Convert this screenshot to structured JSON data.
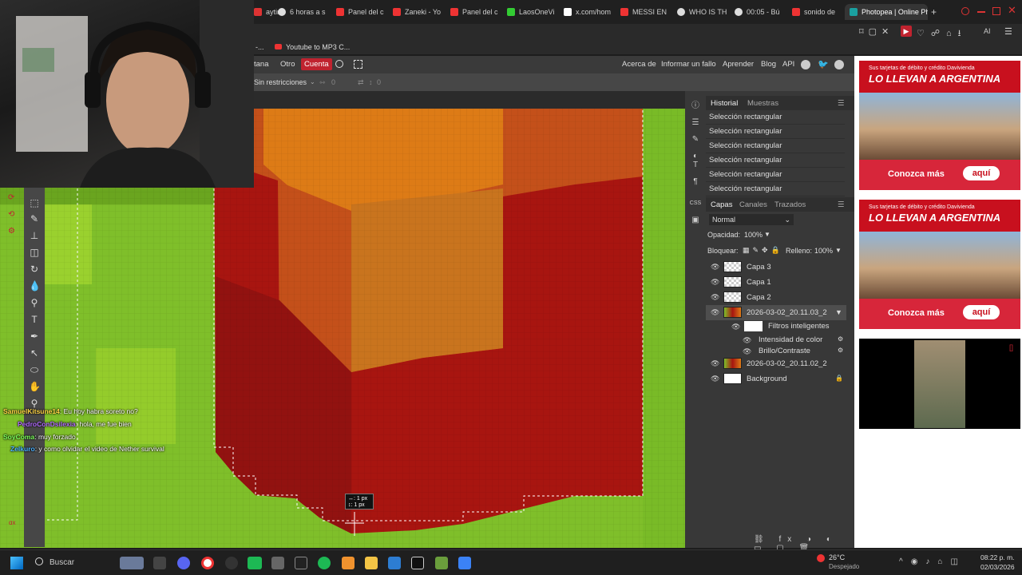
{
  "browser": {
    "tabs": [
      {
        "label": "aytin",
        "color": "#d33"
      },
      {
        "label": "6 horas a s",
        "color": "#ddd"
      },
      {
        "label": "Panel del c",
        "color": "#e33"
      },
      {
        "label": "Zaneki - Yo",
        "color": "#e33"
      },
      {
        "label": "Panel del c",
        "color": "#e33"
      },
      {
        "label": "LaosOneVi",
        "color": "#3c3"
      },
      {
        "label": "x.com/hom",
        "color": "#fff"
      },
      {
        "label": "MESSI EN",
        "color": "#e33"
      },
      {
        "label": "WHO IS TH",
        "color": "#ddd"
      },
      {
        "label": "00:05 - Bú",
        "color": "#ddd"
      },
      {
        "label": "sonido de",
        "color": "#e33"
      },
      {
        "label": "Photopea | Online Ph",
        "color": "#1aa0a0"
      }
    ],
    "new_tab": "+",
    "bookmark": "Youtube to MP3 C...",
    "bookmark_prefix": "-..."
  },
  "menu": {
    "items": [
      "tana",
      "Otro"
    ],
    "account": "Cuenta",
    "right_links": [
      "Acerca de",
      "Informar un fallo",
      "Aprender",
      "Blog",
      "API"
    ]
  },
  "options": {
    "style": "Sin restricciones",
    "width": "0",
    "height": "0"
  },
  "history_panel": {
    "tabs": [
      "Historial",
      "Muestras"
    ],
    "entries": [
      "Selección rectangular",
      "Selección rectangular",
      "Selección rectangular",
      "Selección rectangular",
      "Selección rectangular",
      "Selección rectangular"
    ]
  },
  "layers_panel": {
    "tabs": [
      "Capas",
      "Canales",
      "Trazados"
    ],
    "blend_mode": "Normal",
    "opacity_label": "Opacidad:",
    "opacity_value": "100%",
    "lock_label": "Bloquear:",
    "fill_label": "Relleno:",
    "fill_value": "100%",
    "layers": [
      {
        "name": "Capa 3",
        "thumb": "checker"
      },
      {
        "name": "Capa 1",
        "thumb": "checker"
      },
      {
        "name": "Capa 2",
        "thumb": "checker"
      },
      {
        "name": "2026-03-02_20.11.03_2",
        "thumb": "photo",
        "selected": true
      }
    ],
    "smart_filters_label": "Filtros inteligentes",
    "filters": [
      "Intensidad de color",
      "Brillo/Contraste"
    ],
    "more_layers": [
      {
        "name": "2026-03-02_20.11.02_2",
        "thumb": "photo"
      },
      {
        "name": "Background",
        "thumb": "white"
      }
    ]
  },
  "side_icons": [
    "info-icon",
    "sliders-icon",
    "brush-icon",
    "adjust-icon",
    "text-icon",
    "paragraph-icon",
    "css-icon",
    "image-icon"
  ],
  "side_icon_css": "CSS",
  "canvas": {
    "measure_w": "↔: 1 px",
    "measure_h": "↕: 1 px"
  },
  "ads": [
    {
      "small": "Sus tarjetas de débito y crédito Davivienda",
      "big": "LO LLEVAN A ARGENTINA",
      "cta": "Conozca más",
      "btn": "aquí"
    },
    {
      "small": "Sus tarjetas de débito y crédito Davivienda",
      "big": "LO LLEVAN A ARGENTINA",
      "cta": "Conozca más",
      "btn": "aquí"
    }
  ],
  "chat": [
    {
      "user": "SamuelKitsune14",
      "text": ": Eu hoy habra soreto no?",
      "color": "#ffd447"
    },
    {
      "user": "PedroConDsilexia",
      "text": ": hola, me fue bien",
      "color": "#b26bff"
    },
    {
      "user": "SoyComa",
      "text": ": muy forzado",
      "color": "#7dff5c"
    },
    {
      "user": "Zelkuro",
      "text": ": y como olvidar el video de Nether survival",
      "color": "#4ab0ff"
    }
  ],
  "taskbar": {
    "search": "Buscar",
    "weather_temp": "26°C",
    "weather_desc": "Despejado",
    "time": "08:22 p. m.",
    "date": "02/03/2026"
  },
  "colors": {
    "accent_red": "#c0232f",
    "panel_bg": "#383838",
    "canvas_green": "#7fbf2a",
    "canvas_red": "#a11410",
    "canvas_orange": "#d9780f"
  }
}
